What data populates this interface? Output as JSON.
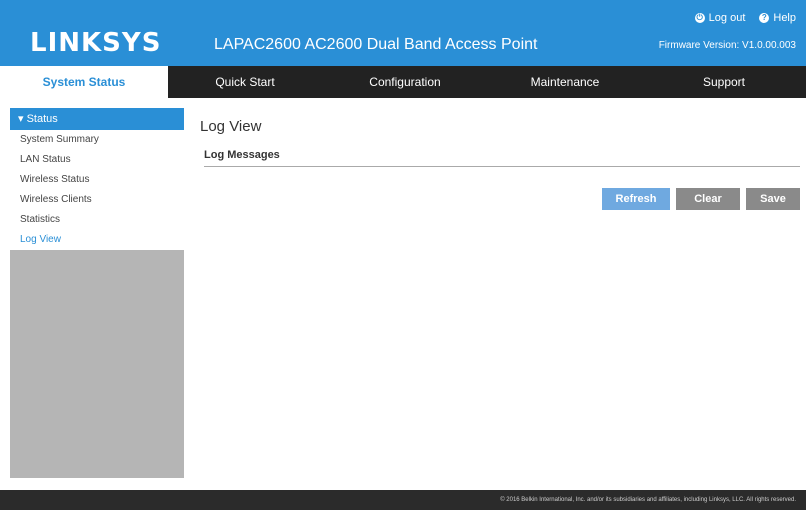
{
  "header": {
    "logo": "LINKSYS",
    "product": "LAPAC2600 AC2600 Dual Band Access Point",
    "logout": "Log out",
    "help": "Help",
    "firmware": "Firmware Version: V1.0.00.003"
  },
  "nav": {
    "items": [
      {
        "label": "System Status"
      },
      {
        "label": "Quick Start"
      },
      {
        "label": "Configuration"
      },
      {
        "label": "Maintenance"
      },
      {
        "label": "Support"
      }
    ],
    "active_index": 0
  },
  "sidebar": {
    "heading": "Status",
    "items": [
      {
        "label": "System Summary"
      },
      {
        "label": "LAN Status"
      },
      {
        "label": "Wireless Status"
      },
      {
        "label": "Wireless Clients"
      },
      {
        "label": "Statistics"
      },
      {
        "label": "Log View"
      }
    ],
    "active_index": 5
  },
  "main": {
    "title": "Log View",
    "section": "Log Messages",
    "buttons": {
      "refresh": "Refresh",
      "clear": "Clear",
      "save": "Save"
    }
  },
  "footer": {
    "text": "© 2016 Belkin International, Inc. and/or its subsidiaries and affiliates, including Linksys, LLC. All rights reserved."
  },
  "colors": {
    "brand_blue": "#2a8fd6",
    "nav_bg": "#222222",
    "sidebar_bg": "#b5b5b5",
    "button_gray": "#8a8a8a",
    "button_blue": "#6fa9e0",
    "footer_bg": "#2b2b2b"
  }
}
